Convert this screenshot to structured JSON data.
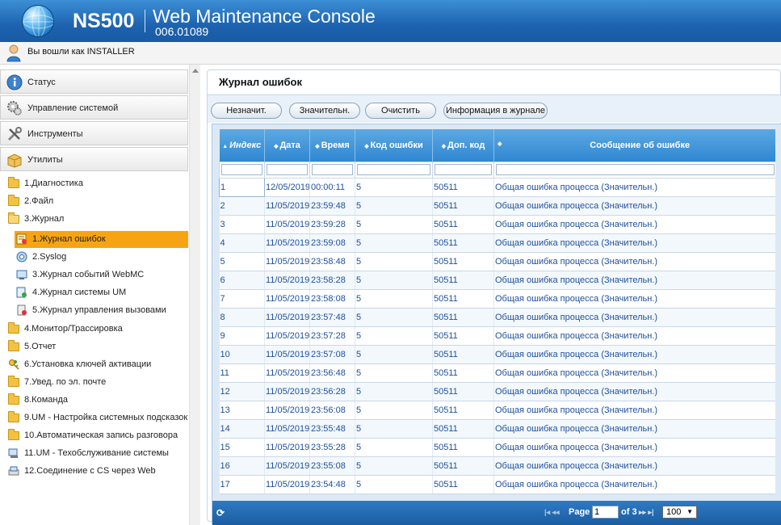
{
  "header": {
    "brand": "NS500",
    "title": "Web Maintenance Console",
    "version": "006.01089"
  },
  "user": {
    "logged_in_text": "Вы вошли как INSTALLER"
  },
  "sidebar": {
    "sections": [
      {
        "label": "Статус",
        "icon": "info-icon"
      },
      {
        "label": "Управление системой",
        "icon": "system-gear-icon"
      },
      {
        "label": "Инструменты",
        "icon": "tools-icon"
      },
      {
        "label": "Утилиты",
        "icon": "utilities-box-icon"
      }
    ],
    "tree": [
      {
        "label": "1.Диагностика",
        "icon": "folder-icon",
        "level": 0
      },
      {
        "label": "2.Файл",
        "icon": "folder-icon",
        "level": 0
      },
      {
        "label": "3.Журнал",
        "icon": "folder-open-icon",
        "level": 0
      },
      {
        "label": "1.Журнал ошибок",
        "icon": "error-log-icon",
        "level": 1,
        "selected": true
      },
      {
        "label": "2.Syslog",
        "icon": "syslog-icon",
        "level": 1
      },
      {
        "label": "3.Журнал событий WebMC",
        "icon": "event-log-icon",
        "level": 1
      },
      {
        "label": "4.Журнал системы UM",
        "icon": "um-log-icon",
        "level": 1
      },
      {
        "label": "5.Журнал управления вызовами",
        "icon": "call-log-icon",
        "level": 1
      },
      {
        "label": "4.Монитор/Трассировка",
        "icon": "folder-icon",
        "level": 0
      },
      {
        "label": "5.Отчет",
        "icon": "folder-icon",
        "level": 0
      },
      {
        "label": "6.Установка ключей активации",
        "icon": "keys-icon",
        "level": 0
      },
      {
        "label": "7.Увед. по эл. почте",
        "icon": "folder-icon",
        "level": 0
      },
      {
        "label": "8.Команда",
        "icon": "folder-icon",
        "level": 0
      },
      {
        "label": "9.UM - Настройка системных подсказок",
        "icon": "folder-icon",
        "level": 0
      },
      {
        "label": "10.Автоматическая запись разговора",
        "icon": "folder-icon",
        "level": 0
      },
      {
        "label": "11.UM - Техобслуживание системы",
        "icon": "maintenance-icon",
        "level": 0
      },
      {
        "label": "12.Соединение с CS через Web",
        "icon": "web-connect-icon",
        "level": 0
      }
    ]
  },
  "panel": {
    "title": "Журнал ошибок",
    "buttons": [
      "Незначит.",
      "Значительн.",
      "Очистить",
      "Информация в журнале"
    ]
  },
  "grid": {
    "columns": [
      "Индекс",
      "Дата",
      "Время",
      "Код ошибки",
      "Доп. код",
      "Сообщение об ошибке"
    ],
    "rows": [
      [
        "1",
        "12/05/2019",
        "00:00:11",
        "5",
        "50511",
        "Общая ошибка процесса (Значительн.)"
      ],
      [
        "2",
        "11/05/2019",
        "23:59:48",
        "5",
        "50511",
        "Общая ошибка процесса (Значительн.)"
      ],
      [
        "3",
        "11/05/2019",
        "23:59:28",
        "5",
        "50511",
        "Общая ошибка процесса (Значительн.)"
      ],
      [
        "4",
        "11/05/2019",
        "23:59:08",
        "5",
        "50511",
        "Общая ошибка процесса (Значительн.)"
      ],
      [
        "5",
        "11/05/2019",
        "23:58:48",
        "5",
        "50511",
        "Общая ошибка процесса (Значительн.)"
      ],
      [
        "6",
        "11/05/2019",
        "23:58:28",
        "5",
        "50511",
        "Общая ошибка процесса (Значительн.)"
      ],
      [
        "7",
        "11/05/2019",
        "23:58:08",
        "5",
        "50511",
        "Общая ошибка процесса (Значительн.)"
      ],
      [
        "8",
        "11/05/2019",
        "23:57:48",
        "5",
        "50511",
        "Общая ошибка процесса (Значительн.)"
      ],
      [
        "9",
        "11/05/2019",
        "23:57:28",
        "5",
        "50511",
        "Общая ошибка процесса (Значительн.)"
      ],
      [
        "10",
        "11/05/2019",
        "23:57:08",
        "5",
        "50511",
        "Общая ошибка процесса (Значительн.)"
      ],
      [
        "11",
        "11/05/2019",
        "23:56:48",
        "5",
        "50511",
        "Общая ошибка процесса (Значительн.)"
      ],
      [
        "12",
        "11/05/2019",
        "23:56:28",
        "5",
        "50511",
        "Общая ошибка процесса (Значительн.)"
      ],
      [
        "13",
        "11/05/2019",
        "23:56:08",
        "5",
        "50511",
        "Общая ошибка процесса (Значительн.)"
      ],
      [
        "14",
        "11/05/2019",
        "23:55:48",
        "5",
        "50511",
        "Общая ошибка процесса (Значительн.)"
      ],
      [
        "15",
        "11/05/2019",
        "23:55:28",
        "5",
        "50511",
        "Общая ошибка процесса (Значительн.)"
      ],
      [
        "16",
        "11/05/2019",
        "23:55:08",
        "5",
        "50511",
        "Общая ошибка процесса (Значительн.)"
      ],
      [
        "17",
        "11/05/2019",
        "23:54:48",
        "5",
        "50511",
        "Общая ошибка процесса (Значительн.)"
      ]
    ]
  },
  "pager": {
    "page_label": "Page",
    "page_value": "1",
    "of_text": "of 3",
    "page_size": "100"
  },
  "colors": {
    "header_blue": "#1d63b0",
    "grid_header": "#3a8fd6",
    "selected_item": "#f7a414",
    "row_text": "#1d4f9d"
  }
}
